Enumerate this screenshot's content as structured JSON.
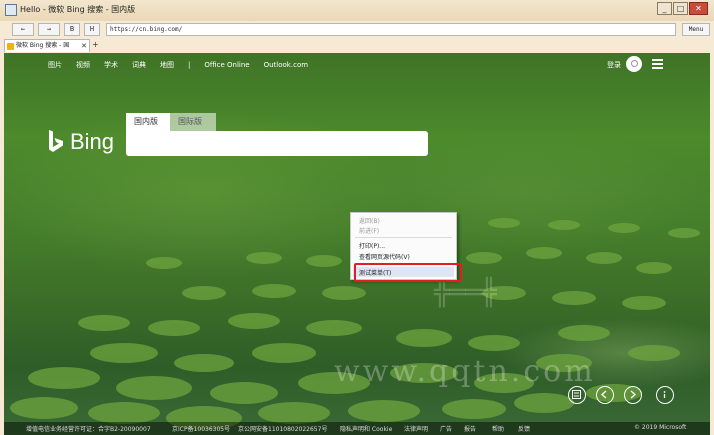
{
  "window": {
    "title": "Hello - 微软 Bing 搜索 - 国内版",
    "buttons": [
      "_",
      "□",
      "✕"
    ]
  },
  "toolbar": {
    "back": "←",
    "forward": "→",
    "btn_b": "B",
    "btn_h": "H",
    "url": "https://cn.bing.com/",
    "menu": "Menu"
  },
  "tab": {
    "label": "微软 Bing 搜索 - 国",
    "close": "✕",
    "add": "+"
  },
  "bing": {
    "nav": [
      "图片",
      "视频",
      "学术",
      "词典",
      "地图",
      "|",
      "Office Online",
      "Outlook.com"
    ],
    "signin": "登录",
    "logo_text": "Bing",
    "search_tabs": [
      "国内版",
      "国际版"
    ],
    "search_value": ""
  },
  "context_menu": {
    "items": [
      "返回(B)",
      "前进(F)",
      "打印(P)...",
      "查看网页源代码(V)",
      "测试菜单(T)"
    ]
  },
  "footer": {
    "items": [
      "增值电信业务经营许可证：合字B2-20090007",
      "京ICP备10036305号",
      "京公网安备11010802022657号",
      "隐私声明和 Cookie",
      "法律声明",
      "广告",
      "报告",
      "帮助",
      "反馈",
      "© 2019 Microsoft"
    ]
  },
  "watermark": "www.qqtn.com"
}
